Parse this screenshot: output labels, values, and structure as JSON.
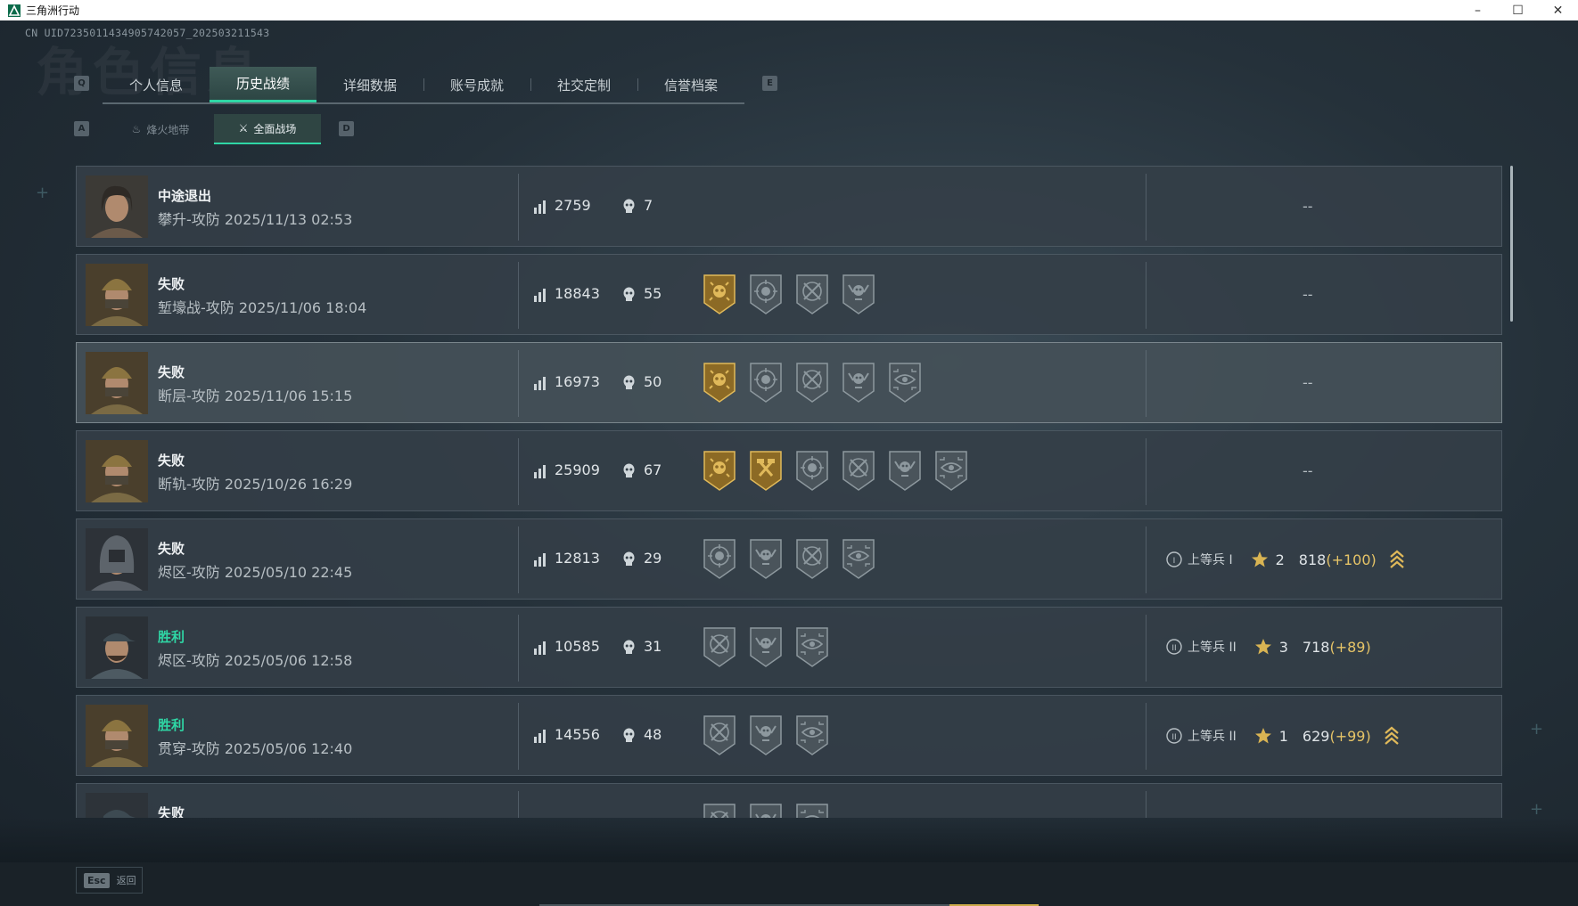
{
  "window": {
    "title": "三角洲行动",
    "controls": [
      "–",
      "☐",
      "✕"
    ]
  },
  "uid": "CN UID7235011434905742057_202503211543",
  "ghost_title": "角色信息",
  "keys": {
    "prev_tab": "Q",
    "next_tab": "E",
    "prev_sub": "A",
    "next_sub": "D"
  },
  "tabs": [
    {
      "label": "个人信息"
    },
    {
      "label": "历史战绩",
      "active": true
    },
    {
      "label": "详细数据"
    },
    {
      "label": "账号成就"
    },
    {
      "label": "社交定制"
    },
    {
      "label": "信誉档案"
    }
  ],
  "subtabs": [
    {
      "label": "烽火地带",
      "icon": "flame-zone-icon"
    },
    {
      "label": "全面战场",
      "icon": "battlefield-icon",
      "active": true
    }
  ],
  "colors": {
    "accent": "#2fd6a5",
    "win": "#2fd6a5",
    "gain": "#e6c467",
    "gold_badge": "#c9a24a"
  },
  "matches": [
    {
      "result": "中途退出",
      "win": false,
      "meta": "攀升-攻防 2025/11/13 02:53",
      "score": "2759",
      "kills": "7",
      "badges": [],
      "rank": null,
      "dash": "--",
      "avatar": "female"
    },
    {
      "result": "失败",
      "win": false,
      "meta": "堑壕战-攻防 2025/11/06 18:04",
      "score": "18843",
      "kills": "55",
      "badges": [
        "gold-skull",
        "target-skull",
        "crossed-guns",
        "winged-skull"
      ],
      "rank": null,
      "dash": "--",
      "avatar": "helmet"
    },
    {
      "result": "失败",
      "win": false,
      "meta": "断层-攻防 2025/11/06 15:15",
      "score": "16973",
      "kills": "50",
      "badges": [
        "gold-skull",
        "target-skull",
        "crossed-guns",
        "winged-skull",
        "eye-scope"
      ],
      "rank": null,
      "dash": "--",
      "avatar": "helmet",
      "highlight": true
    },
    {
      "result": "失败",
      "win": false,
      "meta": "断轨-攻防 2025/10/26 16:29",
      "score": "25909",
      "kills": "67",
      "badges": [
        "gold-skull",
        "gold-hammer",
        "target-skull",
        "crossed-guns",
        "winged-skull",
        "eye-scope"
      ],
      "rank": null,
      "dash": "--",
      "avatar": "helmet"
    },
    {
      "result": "失败",
      "win": false,
      "meta": "烬区-攻防 2025/05/10 22:45",
      "score": "12813",
      "kills": "29",
      "badges": [
        "target-skull",
        "winged-skull",
        "crossed-guns",
        "eye-scope"
      ],
      "rank": {
        "tier": "I",
        "title": "上等兵 I",
        "level": "2",
        "points": "818",
        "gain": "(+100)",
        "chevron": true
      },
      "avatar": "hood"
    },
    {
      "result": "胜利",
      "win": true,
      "meta": "烬区-攻防 2025/05/06 12:58",
      "score": "10585",
      "kills": "31",
      "badges": [
        "crossed-guns",
        "winged-skull",
        "eye-scope"
      ],
      "rank": {
        "tier": "II",
        "title": "上等兵 II",
        "level": "3",
        "points": "718",
        "gain": "(+89)",
        "chevron": false
      },
      "avatar": "cap"
    },
    {
      "result": "胜利",
      "win": true,
      "meta": "贯穿-攻防 2025/05/06 12:40",
      "score": "14556",
      "kills": "48",
      "badges": [
        "crossed-guns",
        "winged-skull",
        "eye-scope"
      ],
      "rank": {
        "tier": "II",
        "title": "上等兵 II",
        "level": "1",
        "points": "629",
        "gain": "(+99)",
        "chevron": true
      },
      "avatar": "helmet"
    },
    {
      "result": "失败",
      "win": false,
      "meta": "",
      "score": "",
      "kills": "",
      "badges": [
        "crossed-guns",
        "winged-skull",
        "eye-scope"
      ],
      "rank": null,
      "dash": "",
      "avatar": "cap2"
    }
  ],
  "footer": {
    "key": "Esc",
    "label": "返回"
  }
}
